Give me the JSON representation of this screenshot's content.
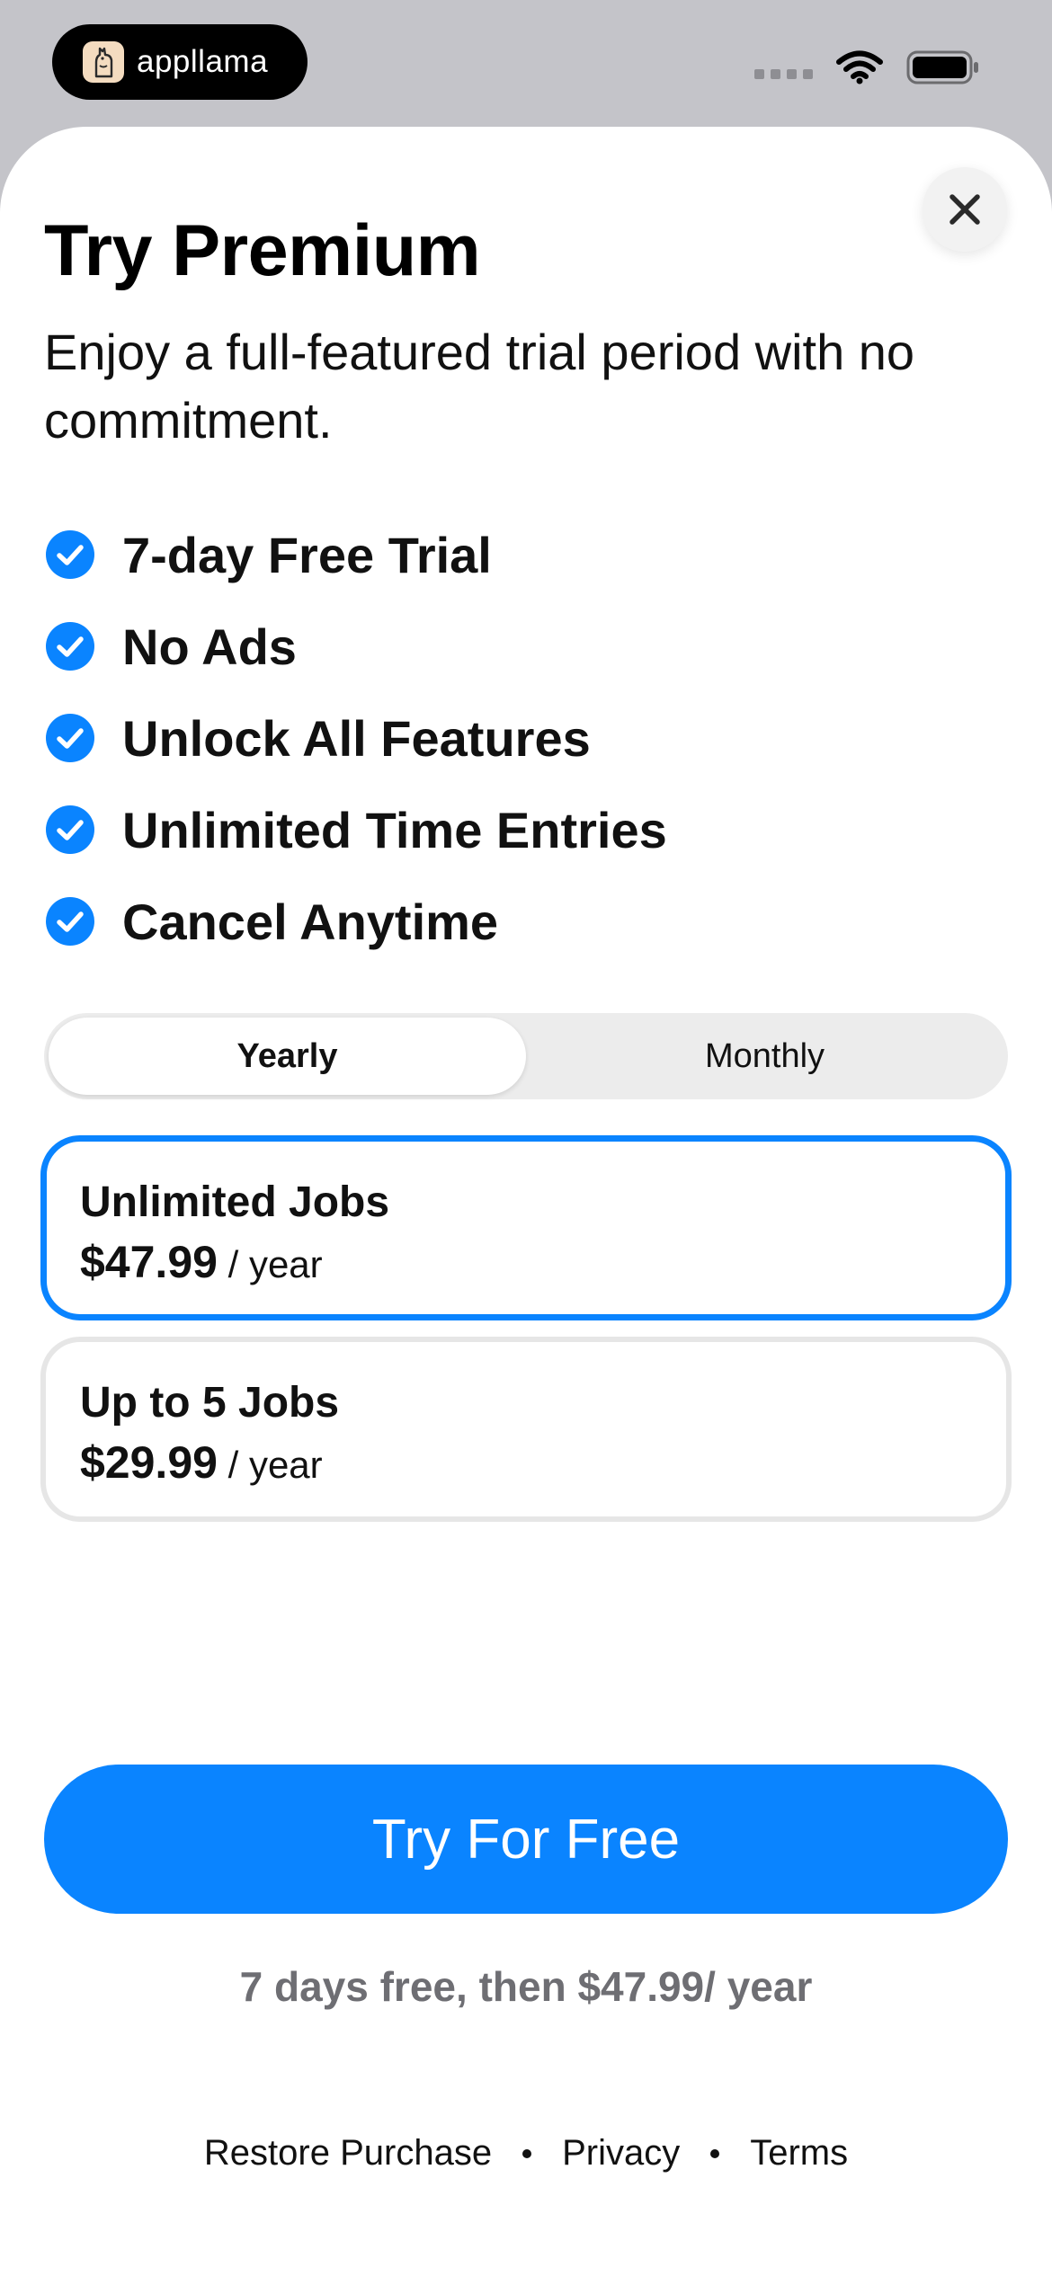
{
  "status_bar": {
    "brand_name": "appllama",
    "icons": [
      "llama-logo-icon",
      "signal-dots-icon",
      "wifi-icon",
      "battery-icon"
    ]
  },
  "sheet": {
    "close_icon": "close-icon",
    "title": "Try Premium",
    "subtitle": "Enjoy a full-featured trial period with no commitment."
  },
  "features": {
    "icon": "checkmark-circle-icon",
    "items": [
      "7-day Free Trial",
      "No Ads",
      "Unlock All Features",
      "Unlimited Time Entries",
      "Cancel Anytime"
    ]
  },
  "billing_toggle": {
    "options": [
      "Yearly",
      "Monthly"
    ],
    "selected": "Yearly"
  },
  "plans": [
    {
      "name": "Unlimited Jobs",
      "price": "$47.99",
      "period": " / year",
      "selected": true
    },
    {
      "name": "Up to 5 Jobs",
      "price": "$29.99",
      "period": " / year",
      "selected": false
    }
  ],
  "cta": {
    "label": "Try For Free",
    "note": "7 days free, then $47.99/ year"
  },
  "footer": {
    "links": [
      "Restore Purchase",
      "Privacy",
      "Terms"
    ]
  },
  "colors": {
    "accent": "#0a84ff",
    "background": "#c4c4c9",
    "sheet": "#ffffff",
    "muted_text": "#6e6e73"
  }
}
